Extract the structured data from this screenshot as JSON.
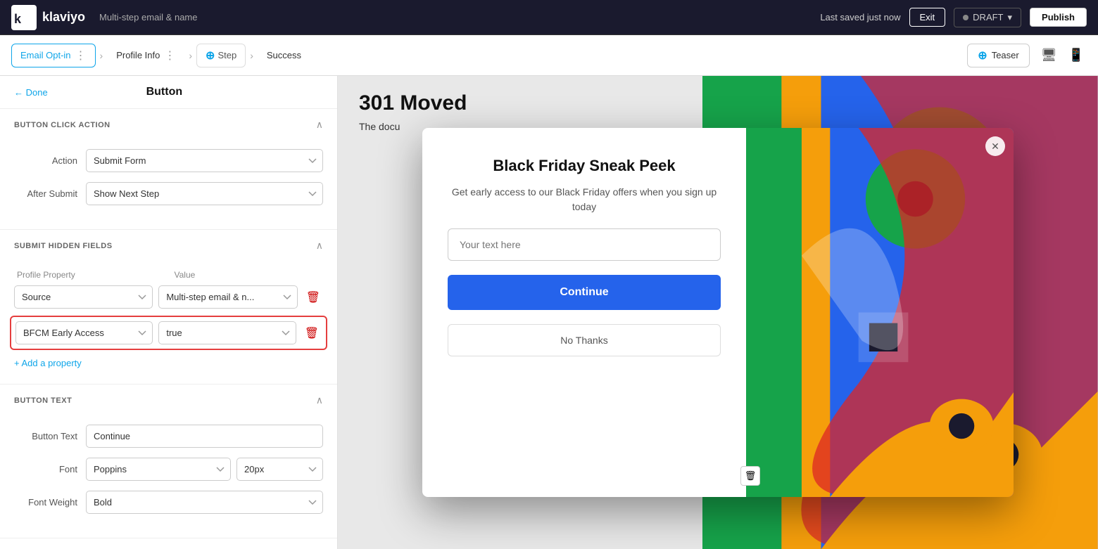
{
  "app": {
    "logo_text": "klaviyo",
    "title": "Multi-step email & name",
    "last_saved": "Last saved just now",
    "exit_label": "Exit",
    "draft_label": "DRAFT",
    "publish_label": "Publish"
  },
  "step_nav": {
    "steps": [
      {
        "id": "email-opt-in",
        "label": "Email Opt-in",
        "active": true
      },
      {
        "id": "profile-info",
        "label": "Profile Info",
        "active": false
      },
      {
        "id": "step",
        "label": "Step",
        "active": false
      },
      {
        "id": "success",
        "label": "Success",
        "active": false
      }
    ],
    "teaser_label": "Teaser",
    "back_label": "← Done",
    "panel_title": "Button"
  },
  "left_panel": {
    "back_label": "← Done",
    "title": "Button",
    "sections": {
      "button_click_action": {
        "title": "BUTTON CLICK ACTION",
        "action_label": "Action",
        "action_value": "Submit Form",
        "after_submit_label": "After Submit",
        "after_submit_value": "Show Next Step"
      },
      "submit_hidden_fields": {
        "title": "SUBMIT HIDDEN FIELDS",
        "profile_property_col": "Profile Property",
        "value_col": "Value",
        "rows": [
          {
            "property": "Source",
            "value": "Multi-step email & n...",
            "highlighted": false
          },
          {
            "property": "BFCM Early Access",
            "value": "true",
            "highlighted": true
          }
        ],
        "add_property_label": "+ Add a property"
      },
      "button_text": {
        "title": "BUTTON TEXT",
        "button_text_label": "Button Text",
        "button_text_value": "Continue",
        "font_label": "Font",
        "font_value": "Poppins",
        "size_value": "20px",
        "font_weight_label": "Font Weight",
        "font_weight_value": "Bold"
      }
    }
  },
  "popup": {
    "title": "Black Friday Sneak Peek",
    "subtitle": "Get early access to our Black Friday offers when you sign up today",
    "input_placeholder": "Your text here",
    "continue_label": "Continue",
    "no_thanks_label": "No Thanks"
  },
  "preview": {
    "page_title": "301 Moved",
    "page_subtitle": "The docu"
  }
}
